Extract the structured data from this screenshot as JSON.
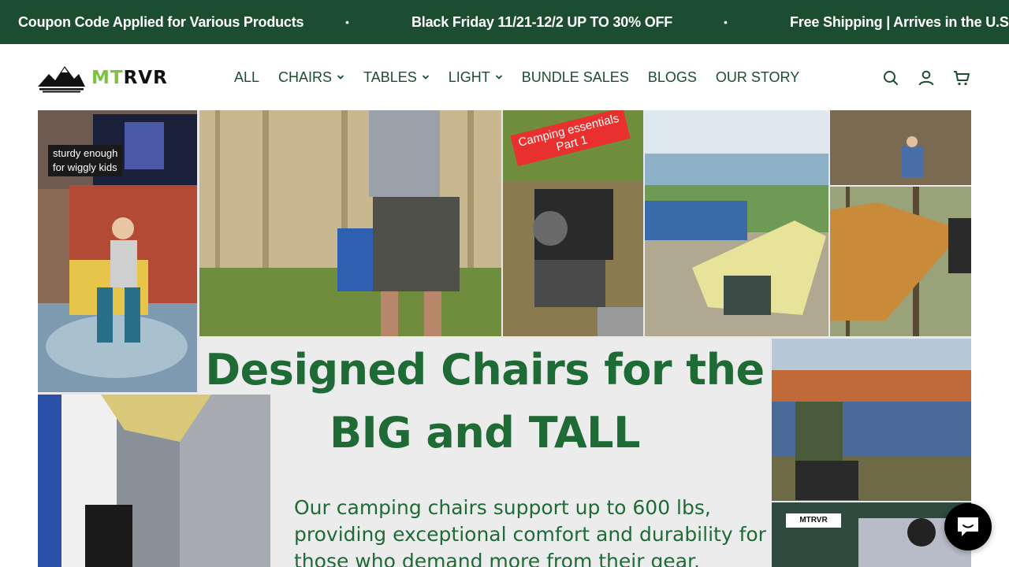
{
  "announcement": {
    "messages": [
      "Coupon Code Applied for Various Products",
      "Black Friday 11/21-12/2 UP TO 30% OFF",
      "Free Shipping | Arrives in the U.S. in"
    ],
    "separator": "•"
  },
  "header": {
    "logo": {
      "mt": "MT",
      "rvr": "RVR"
    },
    "nav": [
      {
        "label": "ALL",
        "dropdown": false
      },
      {
        "label": "CHAIRS",
        "dropdown": true
      },
      {
        "label": "TABLES",
        "dropdown": true
      },
      {
        "label": "LIGHT",
        "dropdown": true
      },
      {
        "label": "BUNDLE SALES",
        "dropdown": false
      },
      {
        "label": "BLOGS",
        "dropdown": false
      },
      {
        "label": "OUR STORY",
        "dropdown": false
      }
    ],
    "icons": [
      "search-icon",
      "account-icon",
      "cart-icon"
    ]
  },
  "hero": {
    "caption_kids": "sturdy enough\nfor wiggly kids",
    "sticker": "Camping essentials\nPart 1",
    "mini_logo": "MTRVR",
    "headline_line1": "Designed Chairs for the",
    "headline_line2": "BIG and TALL",
    "body": "Our camping chairs support up to 600 lbs, providing exceptional comfort and durability for those who demand more from their gear."
  },
  "colors": {
    "brand_green": "#1c4d30",
    "logo_green": "#7cc242",
    "headline_green": "#1f6b36"
  }
}
